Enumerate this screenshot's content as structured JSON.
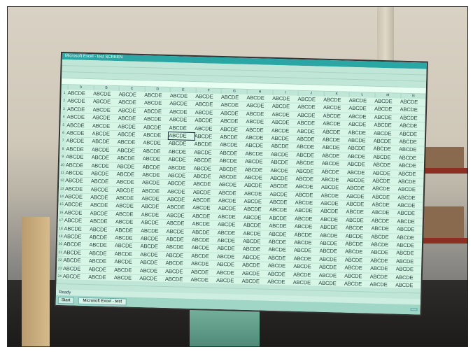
{
  "window": {
    "title": "Microsoft Excel - test SCREEN"
  },
  "sheet": {
    "rows": 26,
    "cols": 14,
    "cell_text": "ABCDE",
    "selected_cell": {
      "row": 6,
      "col": 5
    }
  },
  "status": {
    "text": "Ready"
  },
  "taskbar": {
    "start_label": "Start",
    "active_window": "Microsoft Excel - test"
  }
}
